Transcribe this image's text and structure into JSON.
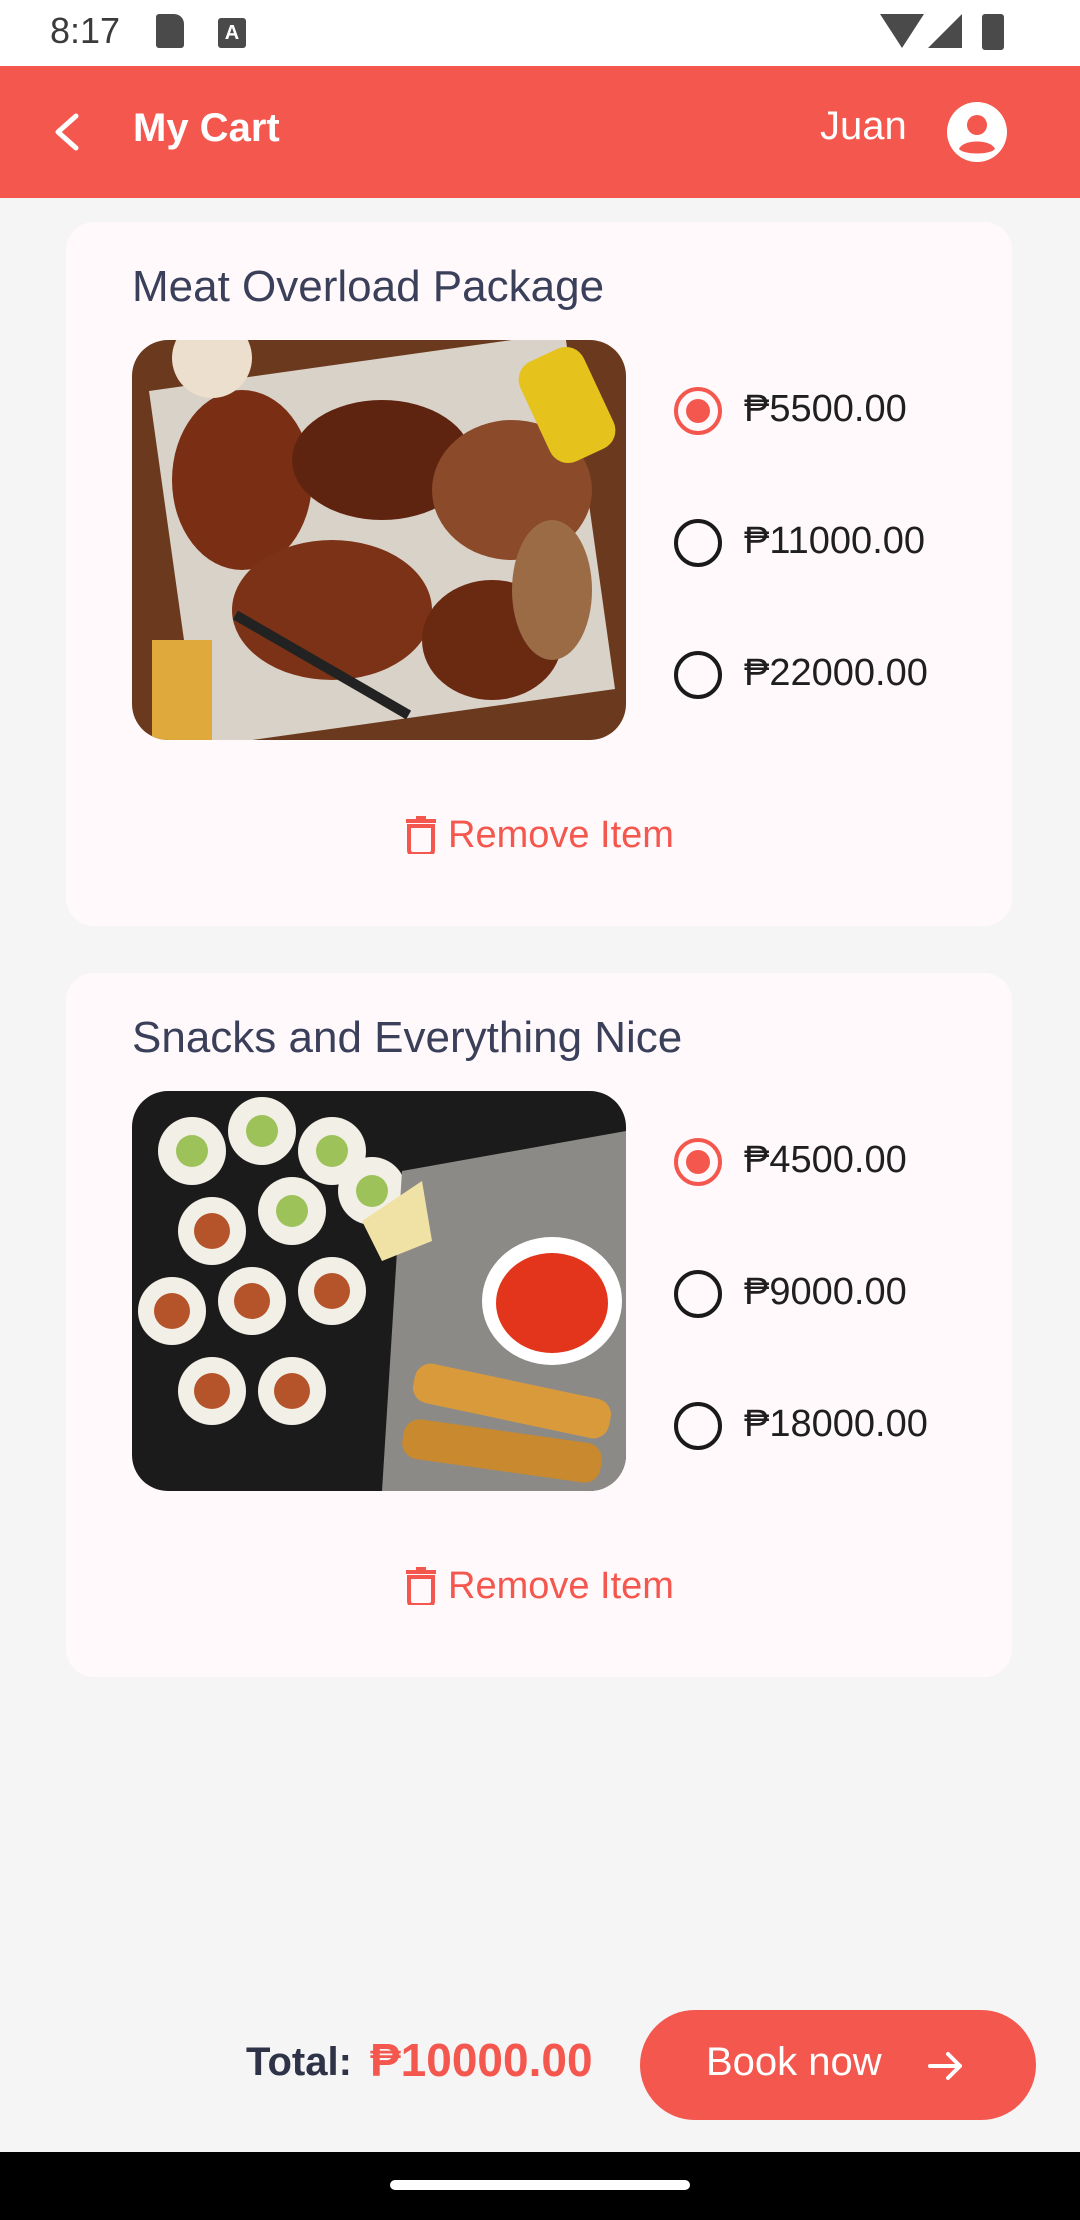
{
  "status_bar": {
    "time": "8:17",
    "icons": [
      "sd-card-icon",
      "a-badge-icon",
      "wifi-icon",
      "cell-signal-icon",
      "battery-icon"
    ]
  },
  "app_bar": {
    "title": "My Cart",
    "user_name": "Juan",
    "back_icon": "chevron-left-icon",
    "avatar_icon": "user-circle-icon"
  },
  "items": [
    {
      "title": "Meat Overload Package",
      "image": "grilled meats platter",
      "options": [
        {
          "label": "₱5500.00",
          "selected": true
        },
        {
          "label": "₱11000.00",
          "selected": false
        },
        {
          "label": "₱22000.00",
          "selected": false
        }
      ],
      "remove_label": "Remove Item"
    },
    {
      "title": "Snacks and Everything Nice",
      "image": "sushi and spring rolls platter",
      "options": [
        {
          "label": "₱4500.00",
          "selected": true
        },
        {
          "label": "₱9000.00",
          "selected": false
        },
        {
          "label": "₱18000.00",
          "selected": false
        }
      ],
      "remove_label": "Remove Item"
    }
  ],
  "footer": {
    "total_label": "Total:",
    "total_value": "₱10000.00",
    "book_label": "Book now"
  },
  "colors": {
    "accent": "#f4574e",
    "card_bg": "#fff9fb",
    "page_bg": "#f5f5f5"
  }
}
